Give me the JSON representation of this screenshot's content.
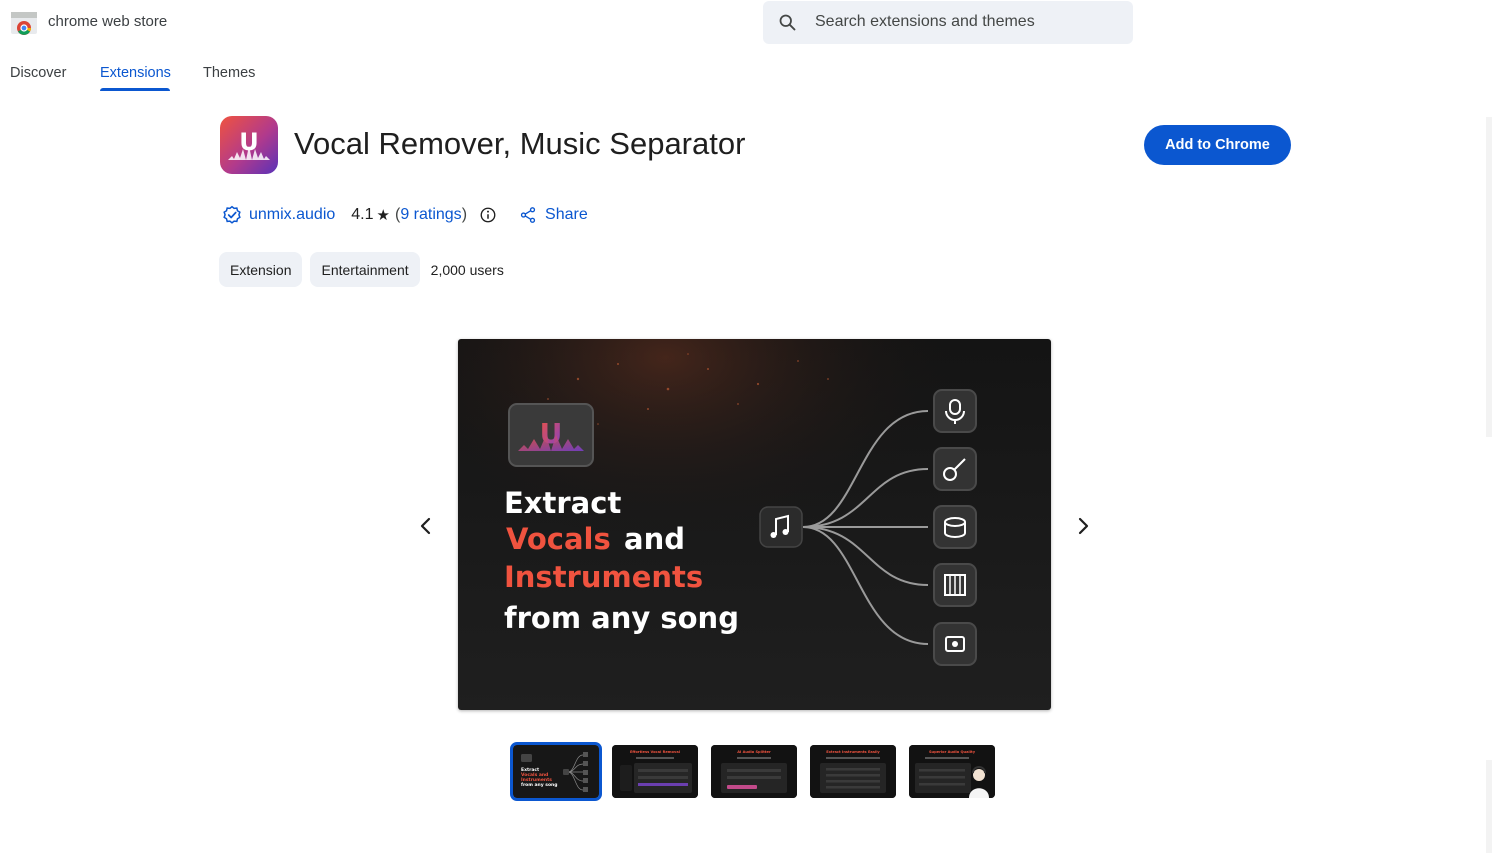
{
  "header": {
    "store_name": "chrome web store",
    "search_placeholder": "Search extensions and themes"
  },
  "tabs": [
    {
      "label": "Discover",
      "active": false
    },
    {
      "label": "Extensions",
      "active": true
    },
    {
      "label": "Themes",
      "active": false
    }
  ],
  "extension": {
    "title": "Vocal Remover, Music Separator",
    "add_button": "Add to Chrome",
    "publisher": "unmix.audio",
    "rating": "4.1",
    "star": "★",
    "ratings_prefix": "(",
    "ratings_count": "9 ratings",
    "ratings_suffix": ")",
    "share": "Share",
    "chips": [
      "Extension",
      "Entertainment"
    ],
    "users": "2,000 users",
    "icon_letter": "U"
  },
  "hero": {
    "line1": "Extract",
    "line2_accent": "Vocals",
    "line2_rest": "and",
    "line3": "Instruments",
    "line4": "from any song",
    "logo_letter": "U"
  },
  "thumbnails": [
    {
      "caption": "Extract Vocals and Instruments from any song",
      "selected": true
    },
    {
      "caption": "Effortless Vocal Removal",
      "selected": false
    },
    {
      "caption": "AI Audio Splitter",
      "selected": false
    },
    {
      "caption": "Extract Instruments Easily",
      "selected": false
    },
    {
      "caption": "Superior Audio Quality",
      "selected": false
    }
  ],
  "colors": {
    "accent": "#0b57d0",
    "hero_accent": "#f0533f",
    "chip_bg": "#eef1f6"
  },
  "icons": [
    "chrome-store-logo-icon",
    "search-icon",
    "verified-icon",
    "star-icon",
    "info-icon",
    "share-icon",
    "chevron-left-icon",
    "chevron-right-icon",
    "microphone-icon",
    "guitar-icon",
    "drum-icon",
    "piano-icon",
    "speaker-icon",
    "music-note-icon"
  ]
}
